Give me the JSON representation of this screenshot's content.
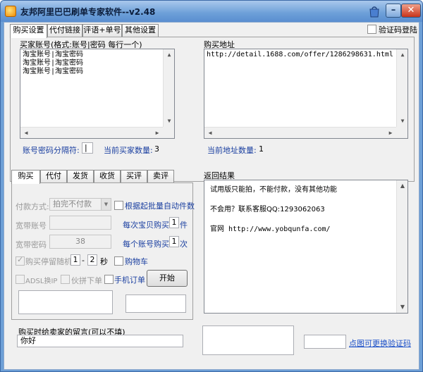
{
  "window": {
    "title": "友邦阿里巴巴刷单专家软件--v2.48",
    "colors": {
      "title_bar": "#6d9fd6",
      "label_blue": "#1a3fa0",
      "link_blue": "#1a4fc8"
    }
  },
  "top_tabs": [
    "购买设置",
    "代付链接",
    "评语+单号",
    "其他设置"
  ],
  "verify_login": {
    "label": "验证码登陆",
    "checked": false
  },
  "buyer_accounts": {
    "title": "买家账号(格式:账号|密码 每行一个)",
    "lines": [
      "淘宝账号|淘宝密码",
      "淘宝账号|淘宝密码",
      "淘宝账号|淘宝密码"
    ],
    "separator_label": "账号密码分隔符:",
    "separator_value": "|",
    "count_label": "当前买家数量:",
    "count_value": "3"
  },
  "purchase_url": {
    "title": "购买地址",
    "value": "http://detail.1688.com/offer/1286298631.html",
    "count_label": "当前地址数量:",
    "count_value": "1"
  },
  "lower_tabs": [
    "购买",
    "代付",
    "发货",
    "收货",
    "买评",
    "卖评"
  ],
  "buy_panel": {
    "payment_label": "付款方式:",
    "payment_value": "拍完不付款",
    "batch_auto": "根据起批量自动件数",
    "broadband_account_label": "宽带账号",
    "broadband_account_value": "",
    "per_item_label": "每次宝贝购买",
    "per_item_value": "1",
    "per_item_unit": "件",
    "broadband_pwd_label": "宽带密码",
    "broadband_pwd_value": "38",
    "per_account_label": "每个账号购买",
    "per_account_value": "1",
    "per_account_unit": "次",
    "random_stay_label": "购买停留随机",
    "random_from": "1",
    "random_dash": "-",
    "random_to": "2",
    "random_unit": "秒",
    "cart_label": "购物车",
    "adsl_label": "ADSL换IP",
    "fake_order_label": "伙拼下单",
    "mobile_order_label": "手机订单",
    "start_button": "开始"
  },
  "result": {
    "title": "返回结果",
    "lines": [
      "试用版只能拍，不能付款，没有其他功能",
      "不会用？联系客服QQ:1293062063",
      "官网 http://www.yobqunfa.com/"
    ]
  },
  "message": {
    "title": "购买时给卖家的留言(可以不填)",
    "value": "你好"
  },
  "captcha": {
    "input_value": "",
    "refresh_link": "点图可更换验证码"
  }
}
